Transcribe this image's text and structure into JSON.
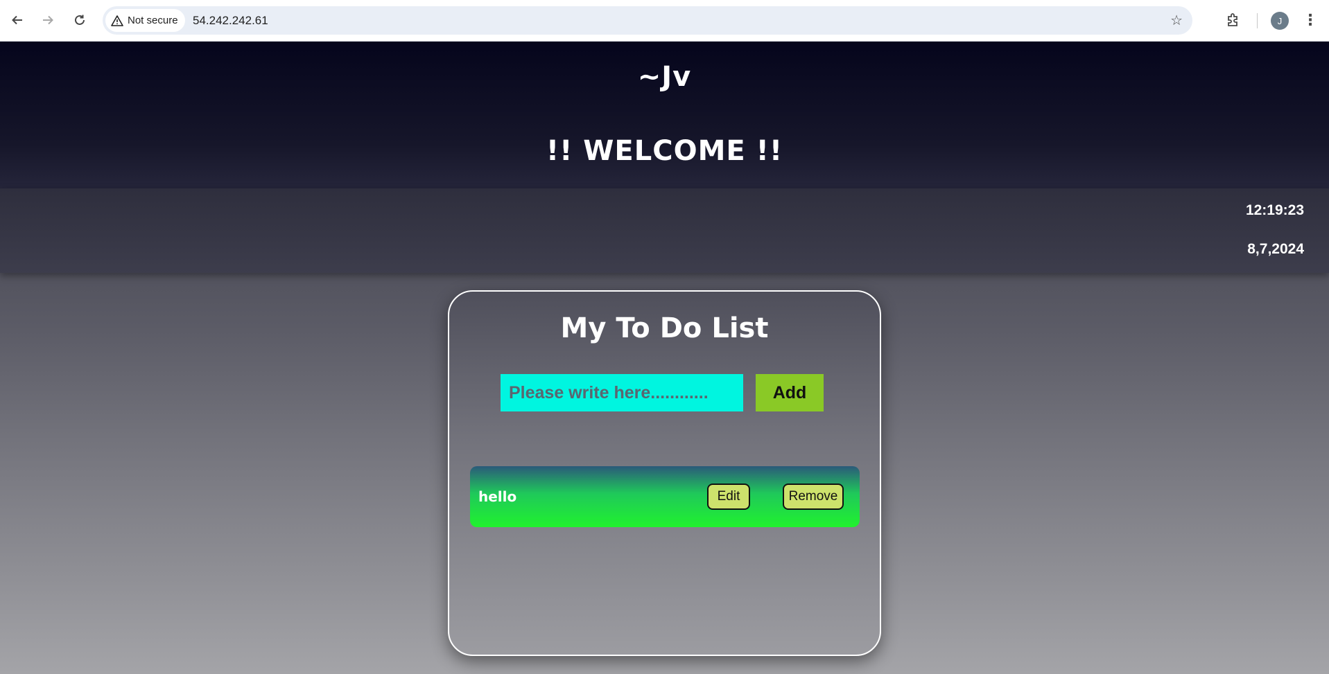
{
  "browser": {
    "back_icon": "arrow-left-icon",
    "forward_icon": "arrow-right-icon",
    "reload_icon": "reload-icon",
    "security_label": "Not secure",
    "url": "54.242.242.61",
    "bookmark_icon": "star-icon",
    "extensions_icon": "puzzle-icon",
    "profile_initial": "J",
    "menu_icon": "kebab-menu-icon"
  },
  "header": {
    "brand": "~Jv",
    "welcome": "!! WELCOME !!"
  },
  "clock": {
    "time": "12:19:23",
    "date": "8,7,2024"
  },
  "todo": {
    "title": "My To Do List",
    "input_placeholder": "Please write here............",
    "input_value": "",
    "add_label": "Add",
    "items": [
      {
        "text": "hello",
        "edit_label": "Edit",
        "remove_label": "Remove"
      }
    ]
  },
  "colors": {
    "input_bg": "#00f5e0",
    "add_button": "#8ac926",
    "item_button": "#cde26c",
    "item_gradient_end": "#21f22e"
  }
}
